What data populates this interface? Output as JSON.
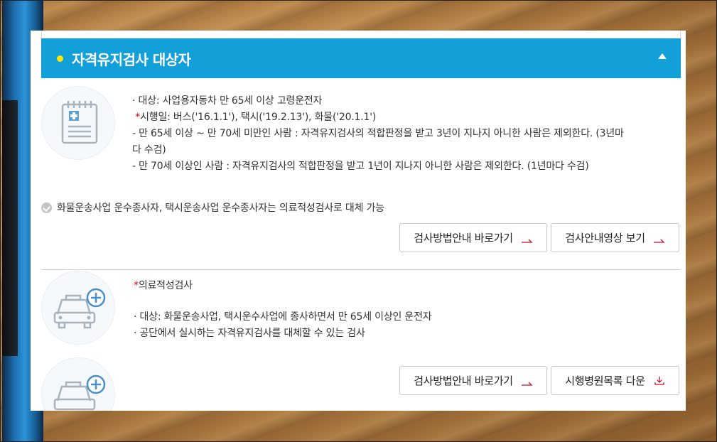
{
  "section": {
    "title": "자격유지검사 대상자"
  },
  "block1": {
    "lines": [
      "· 대상: 사업용자동차 만 65세 이상 고령운전자",
      "시행일: 버스('16.1.1'), 택시('19.2.13'), 화물('20.1.1')",
      " - 만 65세 이상 ~ 만 70세 미만인 사람 : 자격유지검사의 적합판정을 받고 3년이 지나지 아니한 사람은 제외한다. (3년마",
      "다 수검)",
      " - 만 70세 이상인 사람 : 자격유지검사의 적합판정을 받고 1년이 지나지 아니한 사람은 제외한다. (1년마다 수검)"
    ],
    "asterisk": "*"
  },
  "note": {
    "text": "화물운송사업 운수종사자, 택시운송사업 운수종사자는 의료적성검사로 대체 가능"
  },
  "buttons1": {
    "guide": "검사방법안내 바로가기",
    "video": "검사안내영상 보기"
  },
  "block2": {
    "asterisk": "*",
    "title": "의료적성검사",
    "lines": [
      "· 대상: 화물운송사업, 택시운수사업에 종사하면서 만 65세 이상인 운전자",
      "· 공단에서 실시하는 자격유지검사를 대체할 수 있는 검사"
    ]
  },
  "buttons2": {
    "guide": "검사방법안내 바로가기",
    "download": "시행병원목록 다운"
  },
  "colors": {
    "header": "#13a0d8",
    "accent_dot": "#ffe600",
    "required": "#e60012",
    "arrow": "#c8102e"
  },
  "icons": {
    "block1": "clipboard-medical-icon",
    "block2": "taxi-medical-icon",
    "block3": "taxi-medical-icon"
  }
}
